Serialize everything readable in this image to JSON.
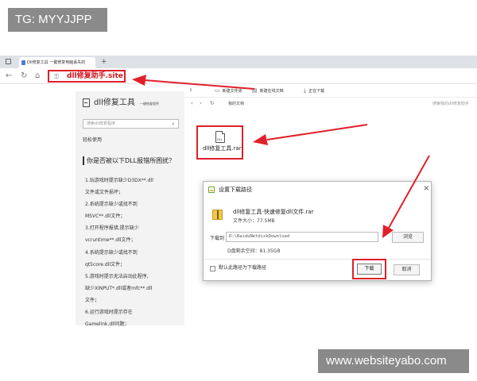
{
  "watermark_top": "TG: MYYJJPP",
  "watermark_bottom": "www.websiteyabo.com",
  "accent_color": "#e0202a",
  "browser": {
    "tab_title": "Dll修复工具 一键修复电脑丢失的",
    "tab_close": "×",
    "new_tab": "+",
    "address_url": "dll修复助手.site",
    "icons": [
      "tab-menu-icon",
      "back-icon",
      "refresh-icon",
      "home-icon",
      "lock-icon"
    ]
  },
  "sidebar": {
    "title": "dll修复工具",
    "subtitle": "一键修复程序",
    "search_placeholder": "搜索dll修复程序",
    "section": "轻松使用",
    "heading": "你是否被以下DLL报错所困扰？",
    "lines": [
      "1.玩游戏时提示缺少D3DX**.dll",
      "文件或文件损坏；",
      "2.系统提示缺少或找不到",
      "MSVC**.dll文件；",
      "3.打开程序报错,提示缺少",
      "vcruntime**.dll文件；",
      "4.系统提示缺少或找不到",
      "qt5core.dll文件；",
      "5.游戏时提示无法启动此程序,",
      "缺少XINPUT*.dll或者mfc**.dll",
      "文件；",
      "6.运行游戏时提示存在",
      "Gamelink.dll问题；"
    ]
  },
  "toolbar": {
    "new_file": "新建文件夹",
    "new_online": "新建在线文档",
    "download_status": "正在下载"
  },
  "path_bar": {
    "breadcrumb": "我的文档",
    "search_placeholder": "搜索我的dll修复助手"
  },
  "file": {
    "icon_label": "DLL",
    "name": "dll修复工具.rar"
  },
  "dialog": {
    "title": "设置下载路径",
    "close": "×",
    "file_name": "dll修复工具-快速修复dll文件.rar",
    "file_size": "文件大小：77.5MB",
    "path_label": "下载到",
    "path_value": "D:\\BaiduNetdiskDownload",
    "browse": "浏览",
    "disk_free": "D盘剩余空间：81.35GB",
    "default_label": "默认此路径为下载路径",
    "download": "下载",
    "cancel": "取消"
  }
}
